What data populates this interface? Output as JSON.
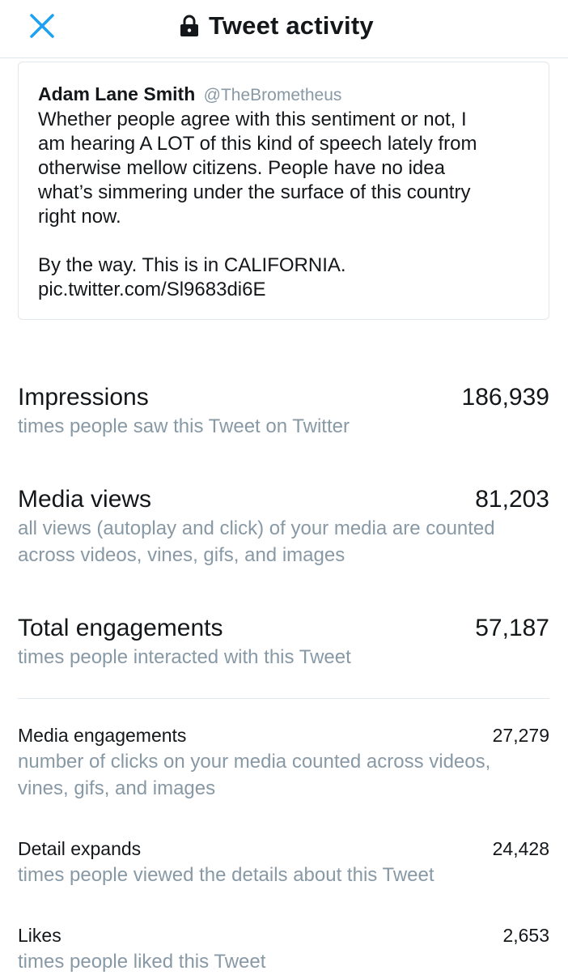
{
  "header": {
    "title": "Tweet activity",
    "close_icon": "close-icon",
    "lock_icon": "lock-icon",
    "accent_color": "#1da1f2"
  },
  "tweet": {
    "author_name": "Adam Lane Smith",
    "author_handle": "@TheBrometheus",
    "text_lines": [
      "Whether people agree with this sentiment or not, I",
      "am hearing A LOT of this kind of speech lately from",
      "otherwise mellow citizens. People have no idea",
      "what’s simmering under the surface of this country",
      "right now.",
      "",
      "By the way. This is in CALIFORNIA.",
      "pic.twitter.com/Sl9683di6E"
    ]
  },
  "metrics": {
    "impressions": {
      "label": "Impressions",
      "value": "186,939",
      "desc_lines": [
        "times people saw this Tweet on Twitter"
      ]
    },
    "media_views": {
      "label": "Media views",
      "value": "81,203",
      "desc_lines": [
        "all views (autoplay and click) of your media are counted",
        "across videos, vines, gifs, and images"
      ]
    },
    "total_engagements": {
      "label": "Total engagements",
      "value": "57,187",
      "desc_lines": [
        "times people interacted with this Tweet"
      ]
    },
    "media_engagements": {
      "label": "Media engagements",
      "value": "27,279",
      "desc_lines": [
        "number of clicks on your media counted across videos,",
        "vines, gifs, and images"
      ]
    },
    "detail_expands": {
      "label": "Detail expands",
      "value": "24,428",
      "desc_lines": [
        "times people viewed the details about this Tweet"
      ]
    },
    "likes": {
      "label": "Likes",
      "value": "2,653",
      "desc_lines": [
        "times people liked this Tweet"
      ]
    }
  }
}
